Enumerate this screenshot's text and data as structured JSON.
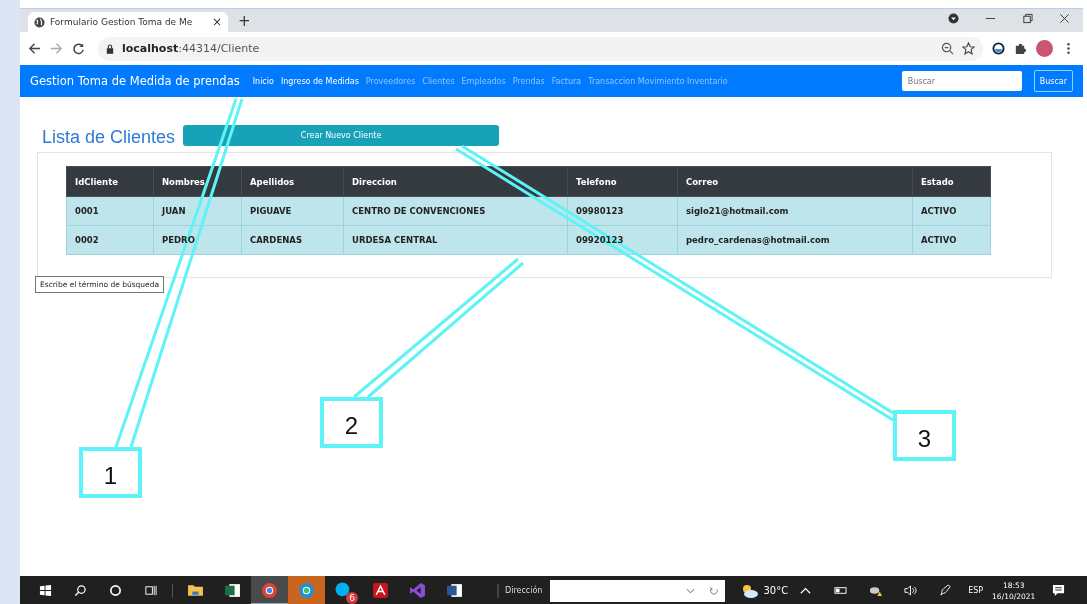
{
  "browser": {
    "tab_title": "Formulario Gestion Toma de Me",
    "tab_close": "×",
    "new_tab": "+",
    "url": "**localhost**:44314/Cliente"
  },
  "navbar": {
    "brand": "Gestion Toma de Medida de prendas",
    "links": [
      {
        "label": "Inicio",
        "active": true
      },
      {
        "label": "Ingreso de Medidas",
        "active": true
      },
      {
        "label": "Proveedores",
        "active": false
      },
      {
        "label": "Clientes",
        "active": false
      },
      {
        "label": "Empleados",
        "active": false
      },
      {
        "label": "Prendas",
        "active": false
      },
      {
        "label": "Factura",
        "active": false
      },
      {
        "label": "Transaccion Movimiento Inventario",
        "active": false
      }
    ],
    "search": {
      "placeholder": "Buscar"
    },
    "search_button": "Buscar"
  },
  "page": {
    "title": "Lista de Clientes",
    "create_button": "Crear Nuevo Cliente"
  },
  "table": {
    "columns": [
      "IdCliente",
      "Nombres",
      "Apellidos",
      "Direccion",
      "Telefono",
      "Correo",
      "Estado"
    ],
    "rows": [
      [
        "0001",
        "JUAN",
        "PIGUAVE",
        "CENTRO DE CONVENCIONES",
        "09980123",
        "siglo21@hotmail.com",
        "ACTIVO"
      ],
      [
        "0002",
        "PEDRO",
        "CARDENAS",
        "URDESA CENTRAL",
        "09920123",
        "pedro_cardenas@hotmail.com",
        "ACTIVO"
      ]
    ]
  },
  "tooltip": "Escribe el término de búsqueda",
  "callouts": [
    "1",
    "2",
    "3"
  ],
  "taskbar": {
    "apps": [
      {
        "kind": "folder",
        "selected": false,
        "flashing": false
      },
      {
        "kind": "excel",
        "selected": false,
        "flashing": false
      },
      {
        "kind": "chrome",
        "selected": true,
        "flashing": false
      },
      {
        "kind": "edge",
        "selected": false,
        "flashing": true
      },
      {
        "kind": "skype",
        "selected": false,
        "flashing": false,
        "badge": "6"
      },
      {
        "kind": "acrobat",
        "selected": false,
        "flashing": false
      },
      {
        "kind": "vs",
        "selected": false,
        "flashing": false
      },
      {
        "kind": "word",
        "selected": false,
        "flashing": false
      }
    ],
    "address_label": "Dirección",
    "temperature": "30°C",
    "language": "ESP",
    "time": "18:53",
    "date": "16/10/2021"
  }
}
